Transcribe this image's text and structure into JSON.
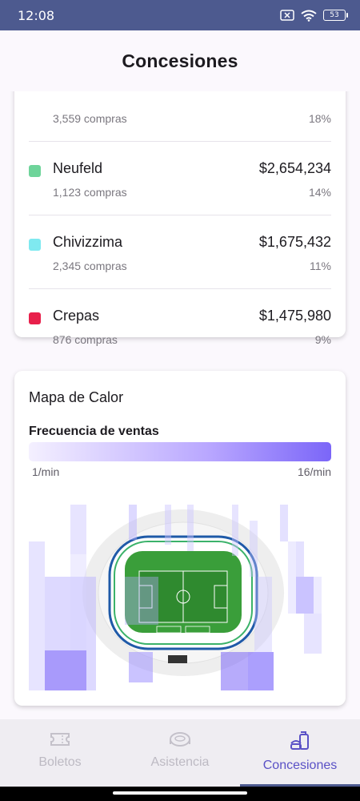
{
  "status_bar": {
    "time": "12:08",
    "battery": "53"
  },
  "header": {
    "title": "Concesiones"
  },
  "concessions": [
    {
      "name": "",
      "purchases": "3,559 compras",
      "amount": "",
      "percent": "18%",
      "color": "#9aa0a8"
    },
    {
      "name": "Neufeld",
      "purchases": "1,123 compras",
      "amount": "$2,654,234",
      "percent": "14%",
      "color": "#6ed49a"
    },
    {
      "name": "Chivizzima",
      "purchases": "2,345 compras",
      "amount": "$1,675,432",
      "percent": "11%",
      "color": "#7fe9f0"
    },
    {
      "name": "Crepas",
      "purchases": "876 compras",
      "amount": "$1,475,980",
      "percent": "9%",
      "color": "#e8204b"
    }
  ],
  "heatmap": {
    "title": "Mapa de Calor",
    "legend_label": "Frecuencia de ventas",
    "min_label": "1/min",
    "max_label": "16/min",
    "color_low": "#f4f0ff",
    "color_high": "#7b66f8"
  },
  "bottom_nav": {
    "items": [
      {
        "label": "Boletos",
        "icon": "ticket-icon",
        "active": false
      },
      {
        "label": "Asistencia",
        "icon": "stadium-icon",
        "active": false
      },
      {
        "label": "Concesiones",
        "icon": "drink-burger-icon",
        "active": true
      }
    ]
  },
  "colors": {
    "status_bar": "#4d5a8f",
    "accent": "#5a51c6",
    "pitch": "#3a9e3a"
  }
}
